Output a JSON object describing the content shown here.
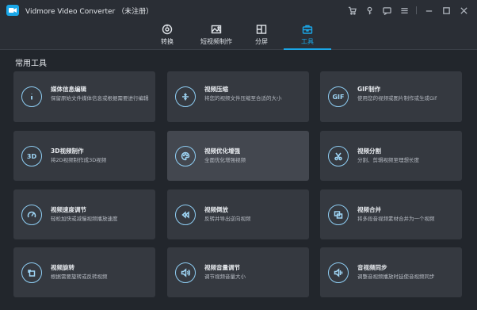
{
  "app": {
    "title": "Vidmore Video Converter （未注册）"
  },
  "titlebar_icons": [
    "cart-icon",
    "key-icon",
    "feedback-icon",
    "menu-icon"
  ],
  "window_controls": [
    "minimize-icon",
    "maximize-icon",
    "close-icon"
  ],
  "tabs": [
    {
      "label": "转换",
      "icon": "convert-icon",
      "active": false
    },
    {
      "label": "短视频制作",
      "icon": "mv-icon",
      "active": false
    },
    {
      "label": "分屏",
      "icon": "collage-icon",
      "active": false
    },
    {
      "label": "工具",
      "icon": "toolbox-icon",
      "active": true
    }
  ],
  "section": {
    "title": "常用工具"
  },
  "tools": [
    {
      "title": "媒体信息编辑",
      "desc": "保留原始文件媒体信息或根据需要进行编辑",
      "icon": "info-icon"
    },
    {
      "title": "视频压缩",
      "desc": "将您的视频文件压缩至合适的大小",
      "icon": "compress-icon"
    },
    {
      "title": "GIF制作",
      "desc": "使用您的视频或图片制作或生成Gif",
      "icon": "gif-icon",
      "icon_text": "GIF"
    },
    {
      "title": "3D视频制作",
      "desc": "将2D视频制作成3D视频",
      "icon": "3d-icon",
      "icon_text": "3D"
    },
    {
      "title": "视频优化增强",
      "desc": "全面优化增强视频",
      "icon": "palette-icon"
    },
    {
      "title": "视频分割",
      "desc": "分割、剪辑视频至理想长度",
      "icon": "scissors-icon"
    },
    {
      "title": "视频速度调节",
      "desc": "轻松加快或减慢视频播放速度",
      "icon": "speedometer-icon"
    },
    {
      "title": "视频倒放",
      "desc": "反转并导出逆向视频",
      "icon": "rewind-icon"
    },
    {
      "title": "视频合并",
      "desc": "将多段音视频素材合并为一个视频",
      "icon": "merge-icon"
    },
    {
      "title": "视频旋转",
      "desc": "根据需要旋转或反转视频",
      "icon": "rotate-icon"
    },
    {
      "title": "视频音量调节",
      "desc": "调节视频音量大小",
      "icon": "volume-icon"
    },
    {
      "title": "音视频同步",
      "desc": "调整音视频播放时延使音视频同步",
      "icon": "sync-icon"
    }
  ],
  "colors": {
    "accent": "#1aa7e8",
    "background": "#22262c",
    "card": "#353940",
    "card_highlight": "#43474f"
  }
}
